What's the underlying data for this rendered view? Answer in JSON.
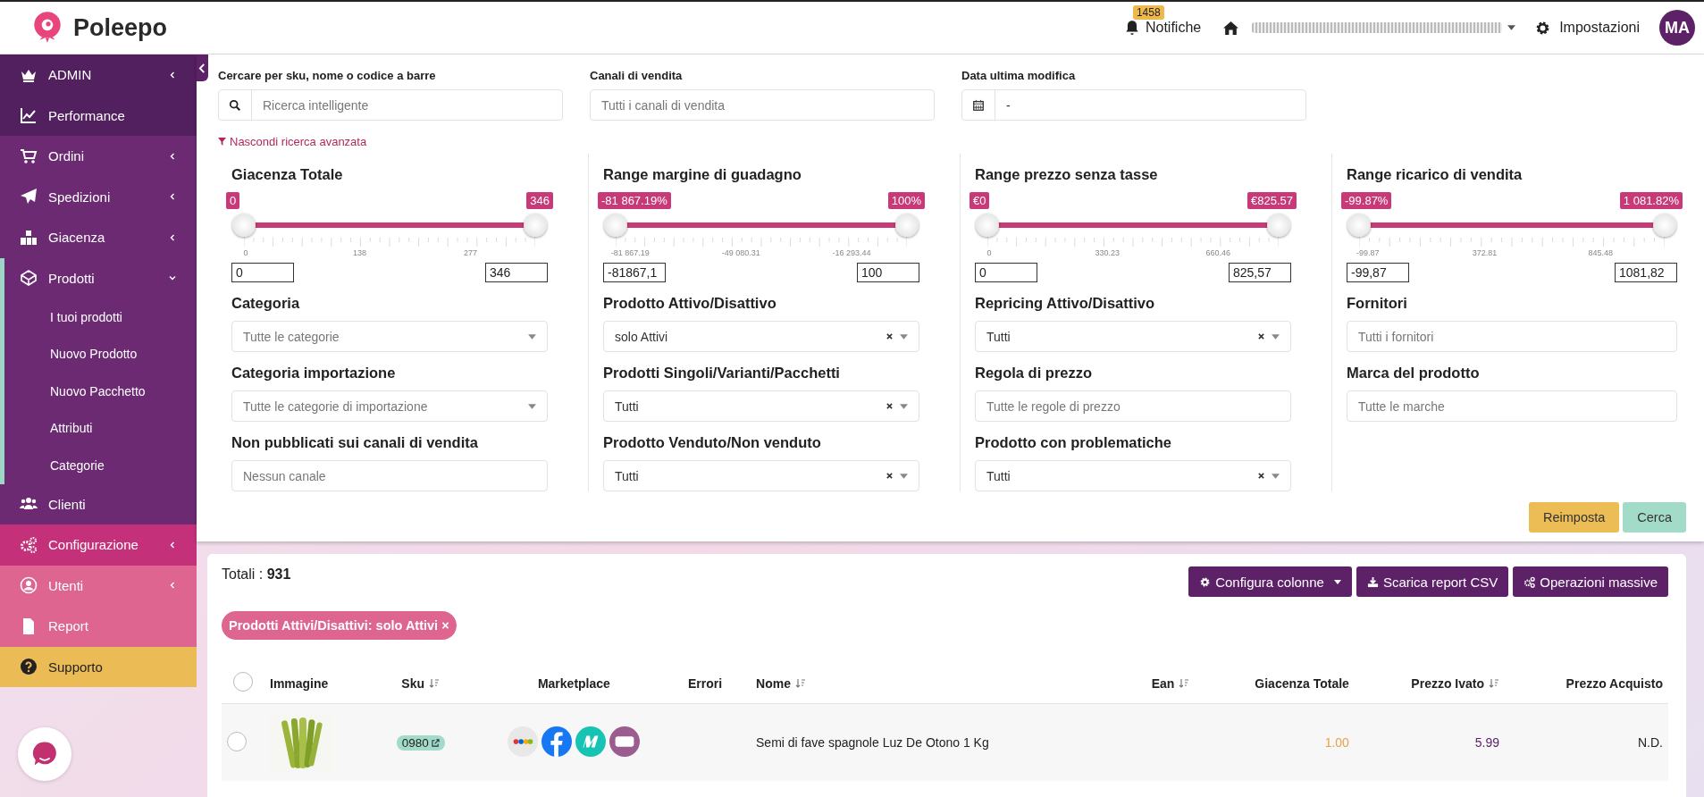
{
  "header": {
    "brand": "Poleepo",
    "notifications": {
      "count": "1458",
      "label": "Notifiche"
    },
    "settings": "Impostazioni",
    "avatar": "MA"
  },
  "sidebar": {
    "items": [
      {
        "label": "ADMIN",
        "color": "#53205f",
        "expanded": false
      },
      {
        "label": "Performance",
        "color": "#53205f"
      },
      {
        "label": "Ordini",
        "color": "#6b2a72",
        "expanded": false
      },
      {
        "label": "Spedizioni",
        "color": "#6b2a72",
        "expanded": false
      },
      {
        "label": "Giacenza",
        "color": "#6b2a72",
        "expanded": false
      },
      {
        "label": "Prodotti",
        "color": "#6b2a72",
        "expanded": true,
        "children": [
          {
            "label": "I tuoi prodotti"
          },
          {
            "label": "Nuovo Prodotto"
          },
          {
            "label": "Nuovo Pacchetto"
          },
          {
            "label": "Attributi"
          },
          {
            "label": "Categorie"
          }
        ]
      },
      {
        "label": "Clienti",
        "color": "#6b2a72"
      },
      {
        "label": "Configurazione",
        "color": "#c4317a",
        "expanded": false
      },
      {
        "label": "Utenti",
        "color": "#dd6590",
        "expanded": false
      },
      {
        "label": "Report",
        "color": "#dd6590"
      },
      {
        "label": "Supporto",
        "color": "#ebbb55"
      }
    ]
  },
  "search": {
    "fields": [
      {
        "label": "Cercare per sku, nome o codice a barre",
        "kind": "search",
        "placeholder": "Ricerca intelligente"
      },
      {
        "label": "Canali di vendita",
        "kind": "text",
        "placeholder": "Tutti i canali di vendita"
      },
      {
        "label": "Data ultima modifica",
        "kind": "date",
        "value": "-"
      }
    ],
    "toggle": "Nascondi ricerca avanzata"
  },
  "filters": [
    {
      "title": "Giacenza Totale",
      "badges": [
        "0",
        "346"
      ],
      "thumbs": [
        {
          "level": 0
        },
        {
          "level": 1
        }
      ],
      "ticks": [
        "0",
        "138",
        "277"
      ],
      "inputs": [
        "0",
        "346"
      ],
      "fields": [
        {
          "label": "Categoria",
          "kind": "select",
          "placeholder": "Tutte le categorie"
        },
        {
          "label": "Categoria importazione",
          "kind": "select",
          "placeholder": "Tutte le categorie di importazione"
        },
        {
          "label": "Non pubblicati sui canali di vendita",
          "kind": "input",
          "placeholder": "Nessun canale"
        }
      ]
    },
    {
      "title": "Range margine di guadagno",
      "badges": [
        "-81 867.19%",
        "100%"
      ],
      "thumbs": [
        {
          "level": 0
        },
        {
          "level": 1
        }
      ],
      "ticks": [
        "-81 867.19",
        "-49 080.31",
        "-16 293.44"
      ],
      "inputs": [
        "-81867,1",
        "100"
      ],
      "fields": [
        {
          "label": "Prodotto Attivo/Disattivo",
          "kind": "clearable",
          "value": "solo Attivi"
        },
        {
          "label": "Prodotti Singoli/Varianti/Pacchetti",
          "kind": "clearable",
          "value": "Tutti"
        },
        {
          "label": "Prodotto Venduto/Non venduto",
          "kind": "clearable",
          "value": "Tutti"
        }
      ]
    },
    {
      "title": "Range prezzo senza tasse",
      "badges": [
        "€0",
        "€825.57"
      ],
      "thumbs": [
        {
          "level": 0
        },
        {
          "level": 1
        }
      ],
      "ticks": [
        "0",
        "330.23",
        "660.46"
      ],
      "inputs": [
        "0",
        "825,57"
      ],
      "fields": [
        {
          "label": "Repricing Attivo/Disattivo",
          "kind": "clearable",
          "value": "Tutti"
        },
        {
          "label": "Regola di prezzo",
          "kind": "input",
          "placeholder": "Tutte le regole di prezzo"
        },
        {
          "label": "Prodotto con problematiche",
          "kind": "clearable",
          "value": "Tutti"
        }
      ]
    },
    {
      "title": "Range ricarico di vendita",
      "badges": [
        "-99.87%",
        "1 081.82%"
      ],
      "thumbs": [
        {
          "level": 0
        },
        {
          "level": 1
        }
      ],
      "ticks": [
        "-99.87",
        "372.81",
        "845.48"
      ],
      "inputs": [
        "-99,87",
        "1081,82"
      ],
      "fields": [
        {
          "label": "Fornitori",
          "kind": "input",
          "placeholder": "Tutti i fornitori"
        },
        {
          "label": "Marca del prodotto",
          "kind": "input",
          "placeholder": "Tutte le marche"
        }
      ]
    }
  ],
  "buttons": [
    {
      "label": "Reimposta",
      "kind": "reset"
    },
    {
      "label": "Cerca",
      "kind": "search"
    }
  ],
  "results": {
    "total": "Totali : **931**",
    "actions": [
      {
        "label": "Configura colonne",
        "caret": true
      },
      {
        "label": "Scarica report CSV",
        "caret": false
      },
      {
        "label": "Operazioni massive",
        "caret": false
      }
    ],
    "chips": [
      {
        "label": "Prodotti Attivi/Disattivi: solo Attivi",
        "remove": "×"
      }
    ]
  },
  "table": {
    "all_checked": false,
    "columns": [
      {
        "label": "Immagine",
        "sortable": false
      },
      {
        "label": "Sku",
        "sortable": true
      },
      {
        "label": "Marketplace",
        "sortable": false
      },
      {
        "label": "Errori",
        "sortable": false
      },
      {
        "label": "Nome",
        "sortable": true
      },
      {
        "label": "Ean",
        "sortable": true
      },
      {
        "label": "Giacenza Totale",
        "sortable": false
      },
      {
        "label": "Prezzo Ivato",
        "sortable": true
      },
      {
        "label": "Prezzo Acquisto",
        "sortable": false
      }
    ],
    "rows": [
      {
        "checked": false,
        "sku": "0980",
        "name": "Semi di fave spagnole Luz De Otono 1 Kg",
        "stock": "1.00",
        "price": "5.99",
        "purchase": "N.D."
      }
    ]
  }
}
